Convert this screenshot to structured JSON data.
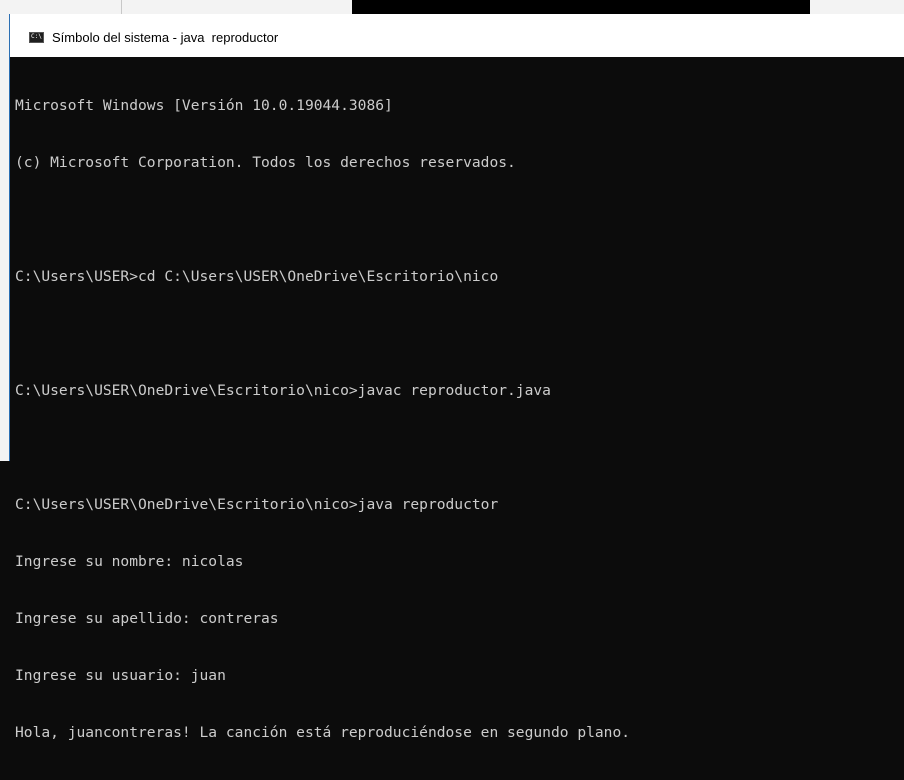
{
  "window": {
    "title": "Símbolo del sistema - java  reproductor",
    "icon": "cmd-icon",
    "icon_text": "C:\\"
  },
  "console": {
    "lines": [
      "Microsoft Windows [Versión 10.0.19044.3086]",
      "(c) Microsoft Corporation. Todos los derechos reservados.",
      "",
      "C:\\Users\\USER>cd C:\\Users\\USER\\OneDrive\\Escritorio\\nico",
      "",
      "C:\\Users\\USER\\OneDrive\\Escritorio\\nico>javac reproductor.java",
      "",
      "C:\\Users\\USER\\OneDrive\\Escritorio\\nico>java reproductor",
      "Ingrese su nombre: nicolas",
      "Ingrese su apellido: contreras",
      "Ingrese su usuario: juan",
      "Hola, juancontreras! La canción está reproduciéndose en segundo plano."
    ]
  },
  "colors": {
    "console_bg": "#0c0c0c",
    "console_text": "#cccccc",
    "titlebar_bg": "#ffffff"
  }
}
